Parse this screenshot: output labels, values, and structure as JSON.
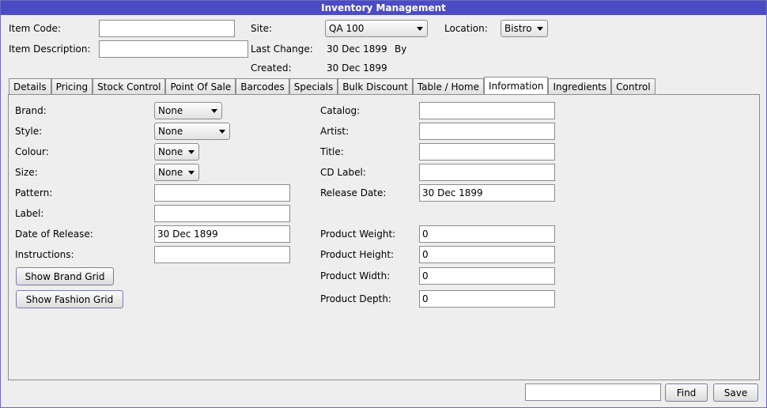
{
  "window": {
    "title": "Inventory Management"
  },
  "header": {
    "item_code_label": "Item Code:",
    "item_code_value": "",
    "item_description_label": "Item Description:",
    "item_description_value": "",
    "site_label": "Site:",
    "site_value": "QA 100",
    "location_label": "Location:",
    "location_value": "Bistro",
    "last_change_label": "Last Change:",
    "last_change_value": "30 Dec 1899",
    "by_label": "By",
    "created_label": "Created:",
    "created_value": "30 Dec 1899"
  },
  "tabs": [
    {
      "label": "Details"
    },
    {
      "label": "Pricing"
    },
    {
      "label": "Stock Control"
    },
    {
      "label": "Point Of Sale"
    },
    {
      "label": "Barcodes"
    },
    {
      "label": "Specials"
    },
    {
      "label": "Bulk Discount"
    },
    {
      "label": "Table / Home"
    },
    {
      "label": "Information",
      "active": true
    },
    {
      "label": "Ingredients"
    },
    {
      "label": "Control"
    }
  ],
  "info": {
    "brand_label": "Brand:",
    "brand_value": "None",
    "style_label": "Style:",
    "style_value": "None",
    "colour_label": "Colour:",
    "colour_value": "None",
    "size_label": "Size:",
    "size_value": "None",
    "pattern_label": "Pattern:",
    "pattern_value": "",
    "label_label": "Label:",
    "label_value": "",
    "date_of_release_label": "Date of Release:",
    "date_of_release_value": "30 Dec 1899",
    "instructions_label": "Instructions:",
    "instructions_value": "",
    "show_brand_grid": "Show Brand Grid",
    "show_fashion_grid": "Show Fashion Grid",
    "catalog_label": "Catalog:",
    "catalog_value": "",
    "artist_label": "Artist:",
    "artist_value": "",
    "title_label": "Title:",
    "title_value": "",
    "cd_label_label": "CD Label:",
    "cd_label_value": "",
    "release_date_label": "Release Date:",
    "release_date_value": "30 Dec 1899",
    "product_weight_label": "Product Weight:",
    "product_weight_value": "0",
    "product_height_label": "Product Height:",
    "product_height_value": "0",
    "product_width_label": "Product Width:",
    "product_width_value": "0",
    "product_depth_label": "Product Depth:",
    "product_depth_value": "0"
  },
  "footer": {
    "find_value": "",
    "find_label": "Find",
    "save_label": "Save"
  }
}
